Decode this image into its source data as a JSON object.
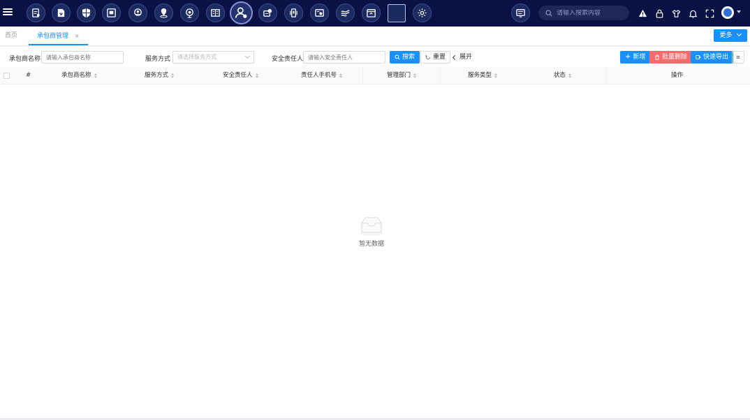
{
  "nav": {
    "modules": [
      {
        "name": "document-icon"
      },
      {
        "name": "report-icon"
      },
      {
        "name": "shield-icon"
      },
      {
        "name": "board-icon"
      },
      {
        "name": "location-icon"
      },
      {
        "name": "map-pin-icon"
      },
      {
        "name": "camera-icon"
      },
      {
        "name": "book-icon"
      },
      {
        "name": "contractor-icon",
        "active": true
      },
      {
        "name": "data-icon"
      },
      {
        "name": "device-icon"
      },
      {
        "name": "inspection-icon"
      },
      {
        "name": "wind-icon"
      },
      {
        "name": "calendar-icon"
      },
      {
        "name": "blank-module"
      },
      {
        "name": "settings-icon"
      }
    ],
    "search_placeholder": "请输入搜索内容"
  },
  "tabs": {
    "home": "首页",
    "current": "承包商管理",
    "close": "×",
    "more": "更多"
  },
  "filters": {
    "contractor_label": "承包商名称",
    "contractor_placeholder": "请输入承包商名称",
    "service_label": "服务方式",
    "service_placeholder": "请选择服务方式",
    "safety_label": "安全责任人",
    "safety_placeholder": "请输入安全责任人",
    "search_btn": "搜索",
    "reset_btn": "重置",
    "expand_btn": "展开"
  },
  "actions": {
    "add": "新增",
    "batch_delete": "批量删除",
    "export": "快速导出"
  },
  "table": {
    "columns": [
      "#",
      "承包商名称",
      "服务方式",
      "安全责任人",
      "责任人手机号",
      "管理部门",
      "服务类型",
      "状态",
      "操作"
    ],
    "empty_text": "暂无数据"
  },
  "colors": {
    "navbar": "#0a1245",
    "primary": "#1890ff",
    "danger": "#f56c6c"
  }
}
